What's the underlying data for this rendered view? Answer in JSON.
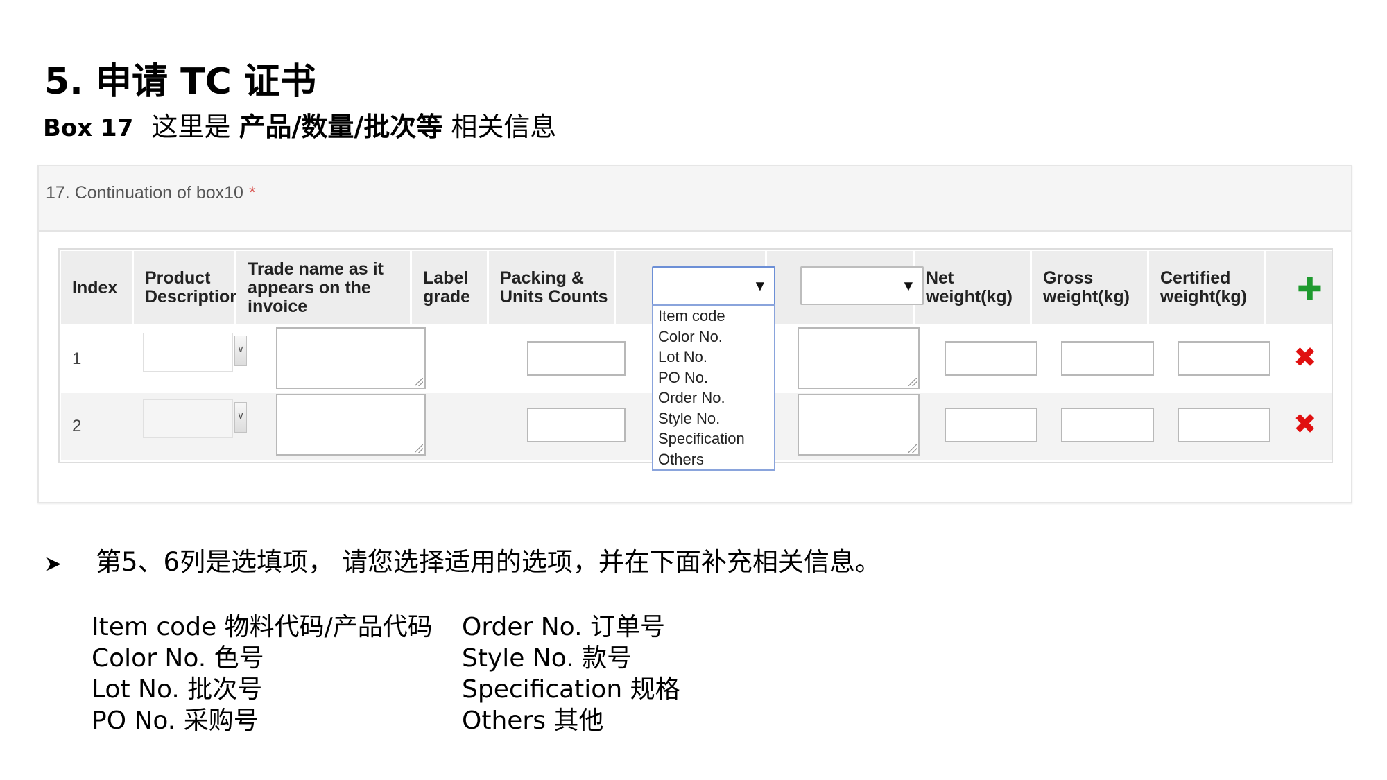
{
  "heading": "5. 申请 TC 证书",
  "subheading": {
    "box_label": "Box 17",
    "text_before": "这里是",
    "text_bold": "产品/数量/批次等",
    "text_after": "相关信息"
  },
  "form": {
    "section_title": "17. Continuation of box10",
    "required_mark": "*",
    "columns": {
      "index": "Index",
      "product_description": "Product Description",
      "trade_name": "Trade name as it appears on the invoice",
      "label_grade": "Label grade",
      "packing_units": "Packing & Units Counts",
      "net_weight": "Net weight(kg)",
      "gross_weight": "Gross weight(kg)",
      "certified_weight": "Certified weight(kg)"
    },
    "add_icon": "plus-icon",
    "delete_icon": "close-icon",
    "rows": [
      {
        "index": "1"
      },
      {
        "index": "2"
      }
    ],
    "dropdown": {
      "selected": "",
      "options": [
        "Item code",
        "Color No.",
        "Lot No.",
        "PO No.",
        "Order No.",
        "Style No.",
        "Specification",
        "Others"
      ]
    },
    "colors": {
      "add": "#1f9a2f",
      "delete": "#e01010",
      "required": "#d9534f"
    }
  },
  "note": "第5、6列是选填项， 请您选择适用的选项，并在下面补充相关信息。",
  "legend": {
    "left": [
      "Item code 物料代码/产品代码",
      "Color No. 色号",
      "Lot No. 批次号",
      "PO No. 采购号"
    ],
    "right": [
      "Order No. 订单号",
      "Style No. 款号",
      "Specification 规格",
      "Others 其他"
    ]
  }
}
